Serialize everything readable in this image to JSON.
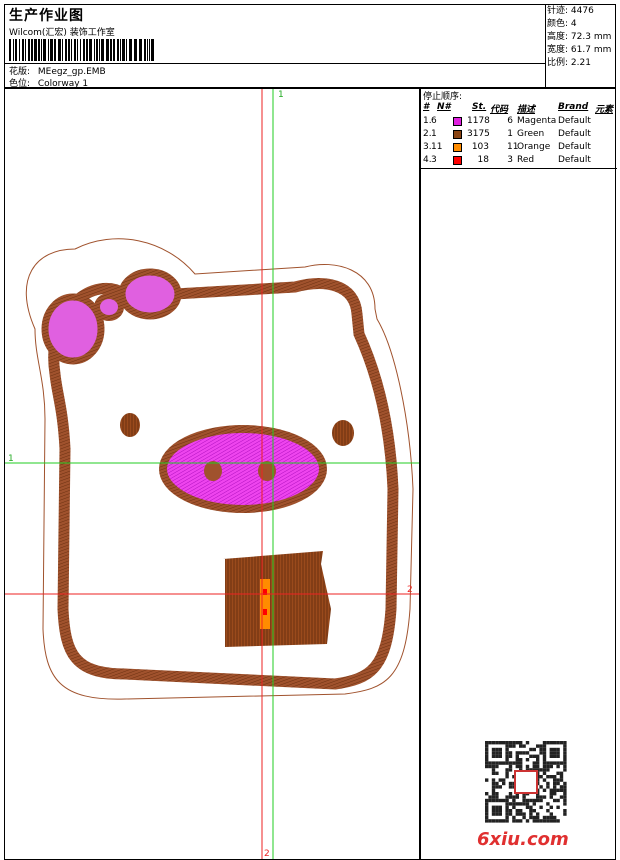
{
  "header": {
    "title": "生产作业图",
    "company": "Wilcom(汇宏) 装饰工作室",
    "design_label": "花版:",
    "design_value": "MEegz_gp.EMB",
    "colorway_label": "色位:",
    "colorway_value": "Colorway 1"
  },
  "stats": {
    "stitches_label": "针迹:",
    "stitches_value": "4476",
    "colors_label": "颜色:",
    "colors_value": "4",
    "height_label": "高度:",
    "height_value": "72.3 mm",
    "width_label": "宽度:",
    "width_value": "61.7 mm",
    "scale_label": "比例:",
    "scale_value": "2.21"
  },
  "canvas": {
    "marker_v1": "1",
    "marker_h1": "1",
    "marker_h2": "2",
    "marker_v2": "2"
  },
  "stop_sequence": {
    "title": "停止顺序:",
    "headers": [
      "#",
      "N#",
      "St.",
      "代码",
      "描述",
      "Brand",
      "元素"
    ],
    "rows": [
      {
        "idx": "1.",
        "n": "6",
        "color": "#e020e0",
        "st": "1178",
        "code": "6",
        "desc": "Magenta",
        "brand": "Default"
      },
      {
        "idx": "2.",
        "n": "1",
        "color": "#8b4513",
        "st": "3175",
        "code": "1",
        "desc": "Green",
        "brand": "Default"
      },
      {
        "idx": "3.",
        "n": "11",
        "color": "#ff8c00",
        "st": "103",
        "code": "11",
        "desc": "Orange",
        "brand": "Default"
      },
      {
        "idx": "4.",
        "n": "3",
        "color": "#ff0000",
        "st": "18",
        "code": "3",
        "desc": "Red",
        "brand": "Default"
      }
    ]
  },
  "watermark": "6xiu.com",
  "colors": {
    "brown": "#8b4513",
    "magenta": "#e020e0",
    "orange": "#ff8c00",
    "red": "#ff0000",
    "guide_green": "#22cc22",
    "guide_red": "#ee2222",
    "outline": "#a0522d"
  }
}
